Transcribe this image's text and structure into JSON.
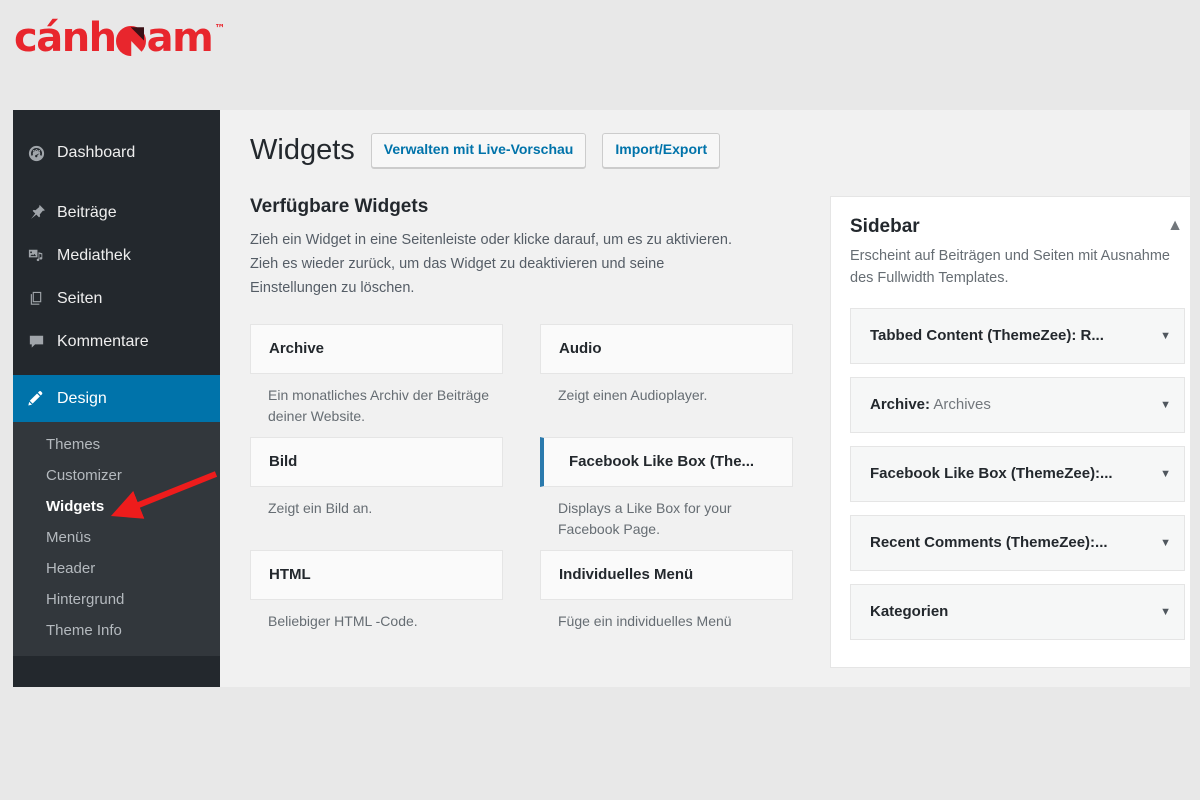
{
  "brand": {
    "name_before": "cánh",
    "name_after": "am",
    "trademark": "™",
    "color": "#e8262d"
  },
  "sidebar": {
    "items": [
      {
        "label": "Dashboard",
        "icon": "dashboard-icon"
      },
      {
        "label": "Beiträge",
        "icon": "pin-icon"
      },
      {
        "label": "Mediathek",
        "icon": "media-icon"
      },
      {
        "label": "Seiten",
        "icon": "pages-icon"
      },
      {
        "label": "Kommentare",
        "icon": "comment-icon"
      },
      {
        "label": "Design",
        "icon": "appearance-brush-icon",
        "current": true
      }
    ],
    "submenu": [
      {
        "label": "Themes"
      },
      {
        "label": "Customizer"
      },
      {
        "label": "Widgets",
        "current": true
      },
      {
        "label": "Menüs"
      },
      {
        "label": "Header"
      },
      {
        "label": "Hintergrund"
      },
      {
        "label": "Theme Info"
      }
    ]
  },
  "main": {
    "page_title": "Widgets",
    "buttons": {
      "live_preview": "Verwalten mit Live-Vorschau",
      "import_export": "Import/Export"
    },
    "available": {
      "title": "Verfügbare Widgets",
      "description": "Zieh ein Widget in eine Seitenleiste oder klicke darauf, um es zu aktivieren. Zieh es wieder zurück, um das Widget zu deaktivieren und seine Einstellungen zu löschen."
    },
    "widgets": [
      {
        "name": "Archive",
        "description": "Ein monatliches Archiv der Beiträge deiner Website.",
        "highlight": false
      },
      {
        "name": "Audio",
        "description": "Zeigt einen Audioplayer.",
        "highlight": false
      },
      {
        "name": "Bild",
        "description": "Zeigt ein Bild an.",
        "highlight": false
      },
      {
        "name": "Facebook Like Box (The...",
        "description": "Displays a Like Box for your Facebook Page.",
        "highlight": true
      },
      {
        "name": "HTML",
        "description": "Beliebiger HTML -Code.",
        "highlight": false
      },
      {
        "name": "Individuelles Menü",
        "description": "Füge ein individuelles Menü",
        "highlight": false
      }
    ]
  },
  "sidebar_panel": {
    "title": "Sidebar",
    "description": "Erscheint auf Beiträgen und Seiten mit Ausnahme des Fullwidth Templates.",
    "collapse_icon": "▲",
    "expand_icon": "▼",
    "rows": [
      {
        "title": "Tabbed Content (ThemeZee): R...",
        "instance": ""
      },
      {
        "title": "Archive:",
        "instance": " Archives"
      },
      {
        "title": "Facebook Like Box (ThemeZee):...",
        "instance": ""
      },
      {
        "title": "Recent Comments (ThemeZee):...",
        "instance": ""
      },
      {
        "title": "Kategorien",
        "instance": ""
      }
    ]
  },
  "annotation": {
    "type": "red-arrow",
    "color": "#ee1c1c",
    "points_to": "Widgets"
  }
}
